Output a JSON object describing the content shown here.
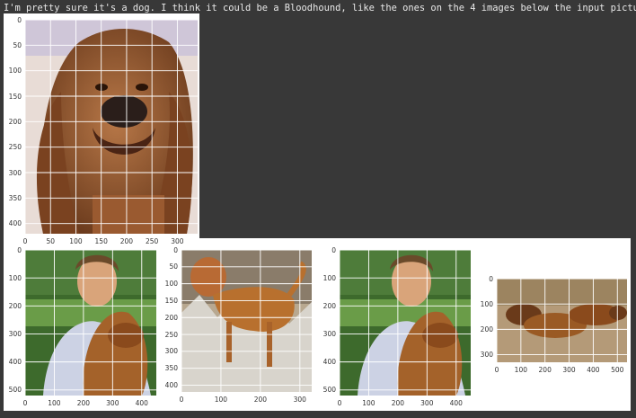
{
  "output": {
    "text": "I'm pretty sure it's a dog. I think it could be a Bloodhound, like the ones on the 4 images below the input picture."
  },
  "figures": [
    {
      "name": "input-figure",
      "image": "bloodhound-face-closeup",
      "xticks": [
        "0",
        "50",
        "100",
        "150",
        "200",
        "250",
        "300"
      ],
      "yticks": [
        "0",
        "50",
        "100",
        "150",
        "200",
        "250",
        "300",
        "350",
        "400"
      ],
      "xlim": [
        0,
        340
      ],
      "ylim": [
        420,
        0
      ]
    },
    {
      "name": "match-1",
      "image": "woman-with-bloodhound",
      "xticks": [
        "0",
        "100",
        "200",
        "300",
        "400"
      ],
      "yticks": [
        "0",
        "100",
        "200",
        "300",
        "400",
        "500"
      ],
      "xlim": [
        0,
        450
      ],
      "ylim": [
        520,
        0
      ]
    },
    {
      "name": "match-2",
      "image": "bloodhound-in-brush",
      "xticks": [
        "0",
        "100",
        "200",
        "300"
      ],
      "yticks": [
        "0",
        "50",
        "100",
        "150",
        "200",
        "250",
        "300",
        "350",
        "400"
      ],
      "xlim": [
        0,
        330
      ],
      "ylim": [
        420,
        0
      ]
    },
    {
      "name": "match-3",
      "image": "woman-with-bloodhound",
      "xticks": [
        "0",
        "100",
        "200",
        "300",
        "400"
      ],
      "yticks": [
        "0",
        "100",
        "200",
        "300",
        "400",
        "500"
      ],
      "xlim": [
        0,
        450
      ],
      "ylim": [
        520,
        0
      ]
    },
    {
      "name": "match-4",
      "image": "two-dogs-lying-on-ground",
      "xticks": [
        "0",
        "100",
        "200",
        "300",
        "400",
        "500"
      ],
      "yticks": [
        "0",
        "100",
        "200",
        "300"
      ],
      "xlim": [
        0,
        540
      ],
      "ylim": [
        330,
        0
      ]
    }
  ]
}
